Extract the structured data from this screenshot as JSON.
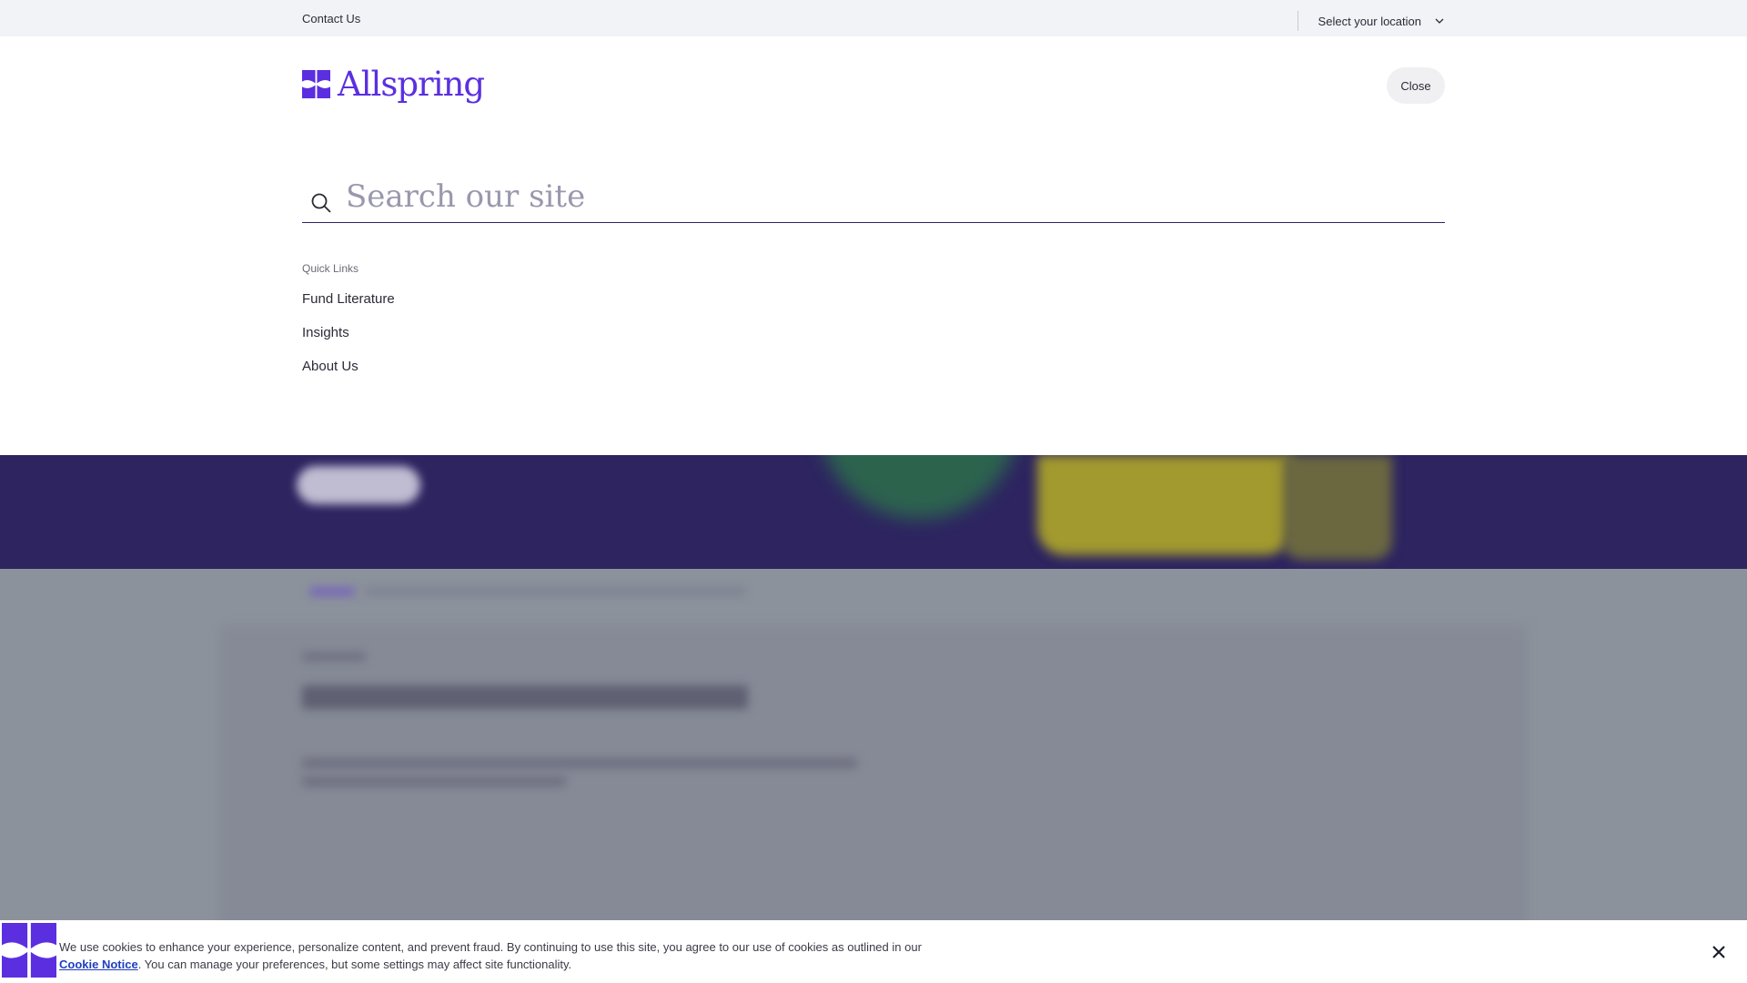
{
  "utility": {
    "contact_label": "Contact Us",
    "location_label": "Select your location"
  },
  "header": {
    "logo_text": "Allspring",
    "close_label": "Close"
  },
  "search": {
    "placeholder": "Search our site",
    "value": ""
  },
  "quick_links": {
    "title": "Quick Links",
    "items": [
      {
        "label": "Fund Literature"
      },
      {
        "label": "Insights"
      },
      {
        "label": "About Us"
      }
    ]
  },
  "cookie": {
    "text_before": "We use cookies to enhance your experience, personalize content, and prevent fraud. By continuing to use this site, you agree to our use of cookies as outlined in our ",
    "link_label": "Cookie Notice",
    "text_after": ". You can manage your preferences, but some settings may affect site functionality."
  },
  "colors": {
    "brand": "#5b2fe0",
    "hero_bg": "#2d2460",
    "link": "#1f3fbf"
  },
  "icons": [
    "chevron-down-icon",
    "allspring-logo-icon",
    "search-icon",
    "close-icon"
  ]
}
